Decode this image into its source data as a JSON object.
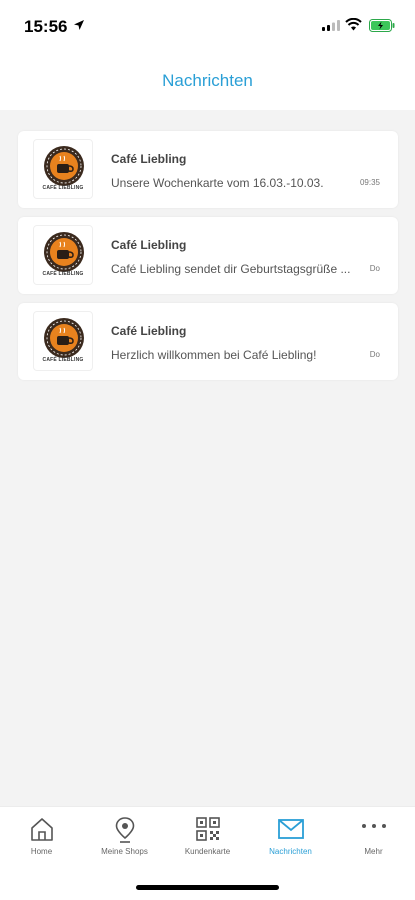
{
  "status_bar": {
    "time": "15:56"
  },
  "header": {
    "title": "Nachrichten"
  },
  "messages": [
    {
      "sender": "Café Liebling",
      "preview": "Unsere Wochenkarte vom 16.03.-10.03.",
      "time": "09:35",
      "avatar_label": "CAFÉ LIEBLING"
    },
    {
      "sender": "Café Liebling",
      "preview": "Café Liebling sendet dir Geburtstagsgrüße ...",
      "time": "Do",
      "avatar_label": "CAFÉ LIEBLING"
    },
    {
      "sender": "Café Liebling",
      "preview": "Herzlich willkommen bei Café Liebling!",
      "time": "Do",
      "avatar_label": "CAFÉ LIEBLING"
    }
  ],
  "tabbar": {
    "items": [
      {
        "label": "Home",
        "icon": "home-icon"
      },
      {
        "label": "Meine Shops",
        "icon": "location-pin-icon"
      },
      {
        "label": "Kundenkarte",
        "icon": "qr-code-icon"
      },
      {
        "label": "Nachrichten",
        "icon": "envelope-icon",
        "active": true
      },
      {
        "label": "Mehr",
        "icon": "more-dots-icon"
      }
    ]
  },
  "colors": {
    "accent": "#2a9fd6",
    "background": "#f3f3f3",
    "card": "#ffffff",
    "logo_orange": "#e8821e"
  }
}
